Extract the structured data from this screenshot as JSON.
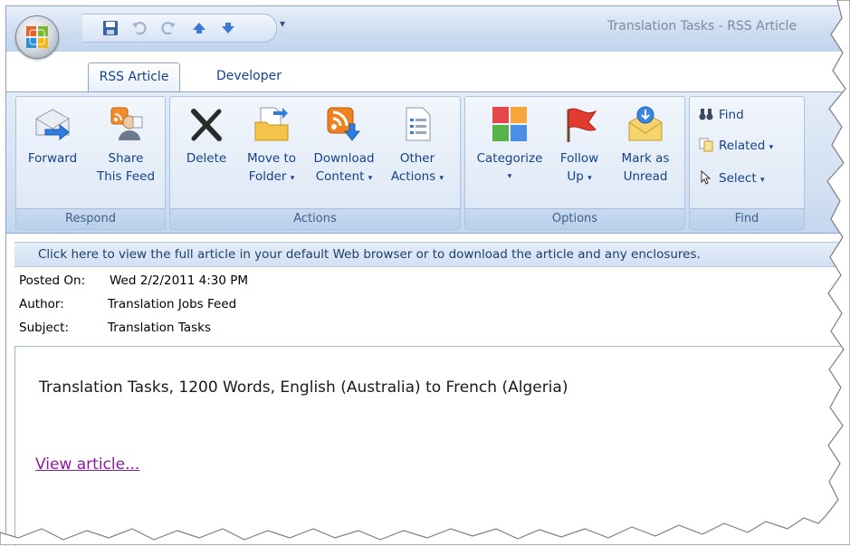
{
  "window": {
    "title": "Translation Tasks - RSS Article"
  },
  "quick_access": {
    "buttons": [
      {
        "icon": "save-icon"
      },
      {
        "icon": "undo-icon"
      },
      {
        "icon": "redo-icon"
      },
      {
        "icon": "previous-item-icon"
      },
      {
        "icon": "next-item-icon"
      }
    ],
    "more": "▾"
  },
  "tabs": [
    {
      "label": "RSS Article",
      "active": true
    },
    {
      "label": "Developer",
      "active": false
    }
  ],
  "ribbon": {
    "respond": {
      "label": "Respond",
      "forward": "Forward",
      "share_line1": "Share",
      "share_line2": "This Feed"
    },
    "actions": {
      "label": "Actions",
      "delete": "Delete",
      "move_line1": "Move to",
      "move_line2": "Folder",
      "download_line1": "Download",
      "download_line2": "Content",
      "other_line1": "Other",
      "other_line2": "Actions"
    },
    "options": {
      "label": "Options",
      "categorize": "Categorize",
      "follow_line1": "Follow",
      "follow_line2": "Up",
      "mark_line1": "Mark as",
      "mark_line2": "Unread"
    },
    "find": {
      "label": "Find",
      "find": "Find",
      "related": "Related",
      "select": "Select"
    },
    "dropdown_arrow": "▾"
  },
  "infobar": {
    "text": "Click here to view the full article in your default Web browser or to download the article and any enclosures."
  },
  "header": {
    "posted_label": "Posted On:",
    "posted_value": "Wed 2/2/2011 4:30 PM",
    "author_label": "Author:",
    "author_value": "Translation Jobs Feed",
    "subject_label": "Subject:",
    "subject_value": "Translation Tasks"
  },
  "body": {
    "text": "Translation Tasks, 1200 Words, English (Australia) to French (Algeria)",
    "link": "View article..."
  },
  "colors": {
    "accent": "#15428b",
    "ribbon": "#d2e0f2",
    "link": "#8a1c9c"
  }
}
